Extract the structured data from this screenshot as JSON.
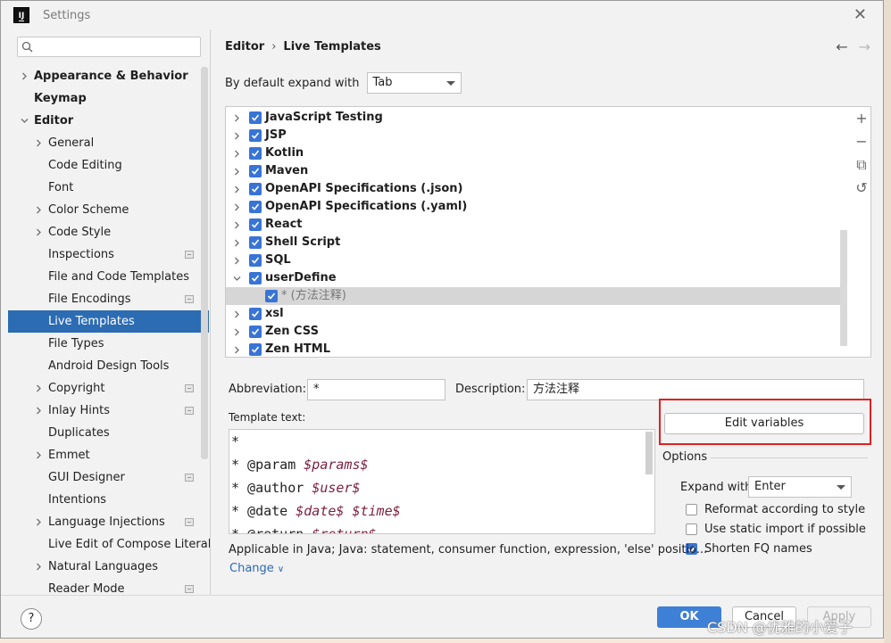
{
  "window": {
    "title": "Settings",
    "app_icon_text": "IJ"
  },
  "sidebar": {
    "search_placeholder": "",
    "items": [
      {
        "label": "Appearance & Behavior",
        "level": 0,
        "expandable": true,
        "expanded": false,
        "bold": true,
        "badge": false
      },
      {
        "label": "Keymap",
        "level": 0,
        "expandable": false,
        "bold": true,
        "badge": false
      },
      {
        "label": "Editor",
        "level": 0,
        "expandable": true,
        "expanded": true,
        "bold": true,
        "badge": false
      },
      {
        "label": "General",
        "level": 1,
        "expandable": true,
        "expanded": false,
        "bold": false,
        "badge": false
      },
      {
        "label": "Code Editing",
        "level": 1,
        "expandable": false,
        "bold": false,
        "badge": false
      },
      {
        "label": "Font",
        "level": 1,
        "expandable": false,
        "bold": false,
        "badge": false
      },
      {
        "label": "Color Scheme",
        "level": 1,
        "expandable": true,
        "expanded": false,
        "bold": false,
        "badge": false
      },
      {
        "label": "Code Style",
        "level": 1,
        "expandable": true,
        "expanded": false,
        "bold": false,
        "badge": false
      },
      {
        "label": "Inspections",
        "level": 1,
        "expandable": false,
        "bold": false,
        "badge": true
      },
      {
        "label": "File and Code Templates",
        "level": 1,
        "expandable": false,
        "bold": false,
        "badge": false
      },
      {
        "label": "File Encodings",
        "level": 1,
        "expandable": false,
        "bold": false,
        "badge": true
      },
      {
        "label": "Live Templates",
        "level": 1,
        "expandable": false,
        "bold": false,
        "badge": false,
        "selected": true
      },
      {
        "label": "File Types",
        "level": 1,
        "expandable": false,
        "bold": false,
        "badge": false
      },
      {
        "label": "Android Design Tools",
        "level": 1,
        "expandable": false,
        "bold": false,
        "badge": false
      },
      {
        "label": "Copyright",
        "level": 1,
        "expandable": true,
        "expanded": false,
        "bold": false,
        "badge": true
      },
      {
        "label": "Inlay Hints",
        "level": 1,
        "expandable": true,
        "expanded": false,
        "bold": false,
        "badge": true
      },
      {
        "label": "Duplicates",
        "level": 1,
        "expandable": false,
        "bold": false,
        "badge": false
      },
      {
        "label": "Emmet",
        "level": 1,
        "expandable": true,
        "expanded": false,
        "bold": false,
        "badge": false
      },
      {
        "label": "GUI Designer",
        "level": 1,
        "expandable": false,
        "bold": false,
        "badge": true
      },
      {
        "label": "Intentions",
        "level": 1,
        "expandable": false,
        "bold": false,
        "badge": false
      },
      {
        "label": "Language Injections",
        "level": 1,
        "expandable": true,
        "expanded": false,
        "bold": false,
        "badge": true
      },
      {
        "label": "Live Edit of Compose Literal",
        "level": 1,
        "expandable": false,
        "bold": false,
        "badge": false
      },
      {
        "label": "Natural Languages",
        "level": 1,
        "expandable": true,
        "expanded": false,
        "bold": false,
        "badge": false
      },
      {
        "label": "Reader Mode",
        "level": 1,
        "expandable": false,
        "bold": false,
        "badge": true
      }
    ]
  },
  "main": {
    "breadcrumb": [
      "Editor",
      "Live Templates"
    ],
    "expand_label": "By default expand with",
    "expand_value": "Tab",
    "template_groups": [
      {
        "label": "JavaScript Testing",
        "checked": true
      },
      {
        "label": "JSP",
        "checked": true
      },
      {
        "label": "Kotlin",
        "checked": true
      },
      {
        "label": "Maven",
        "checked": true
      },
      {
        "label": "OpenAPI Specifications (.json)",
        "checked": true
      },
      {
        "label": "OpenAPI Specifications (.yaml)",
        "checked": true
      },
      {
        "label": "React",
        "checked": true
      },
      {
        "label": "Shell Script",
        "checked": true
      },
      {
        "label": "SQL",
        "checked": true
      },
      {
        "label": "userDefine",
        "checked": true,
        "expanded": true
      },
      {
        "label": "* (方法注释)",
        "checked": true,
        "child": true
      },
      {
        "label": "xsl",
        "checked": true
      },
      {
        "label": "Zen CSS",
        "checked": true
      },
      {
        "label": "Zen HTML",
        "checked": true
      }
    ],
    "abbreviation_label": "Abbreviation:",
    "abbreviation_value": "*",
    "description_label": "Description:",
    "description_value": "方法注释",
    "template_text_label": "Template text:",
    "template_lines": [
      {
        "plain": "*",
        "vars": ""
      },
      {
        "plain": "* @param ",
        "vars": "$params$"
      },
      {
        "plain": "* @author ",
        "vars": "$user$"
      },
      {
        "plain": "* @date ",
        "vars": "$date$ $time$"
      },
      {
        "plain": "* @return ",
        "vars": "$return$"
      }
    ],
    "edit_variables_label": "Edit variables",
    "options_label": "Options",
    "expand_with_label": "Expand with",
    "expand_with_value": "Enter",
    "option_reformat": "Reformat according to style",
    "option_static_import": "Use static import if possible",
    "option_shorten_fq": "Shorten FQ names",
    "applicable_text": "Applicable in Java; Java: statement, consumer function, expression, 'else' positio...",
    "change_label": "Change"
  },
  "footer": {
    "help": "?",
    "ok": "OK",
    "cancel": "Cancel",
    "apply": "Apply"
  },
  "watermark": "CSDN @优雅的小爱子",
  "colors": {
    "selection": "#2c6cb3",
    "accent": "#3874d6",
    "highlight_box": "#e02020"
  }
}
